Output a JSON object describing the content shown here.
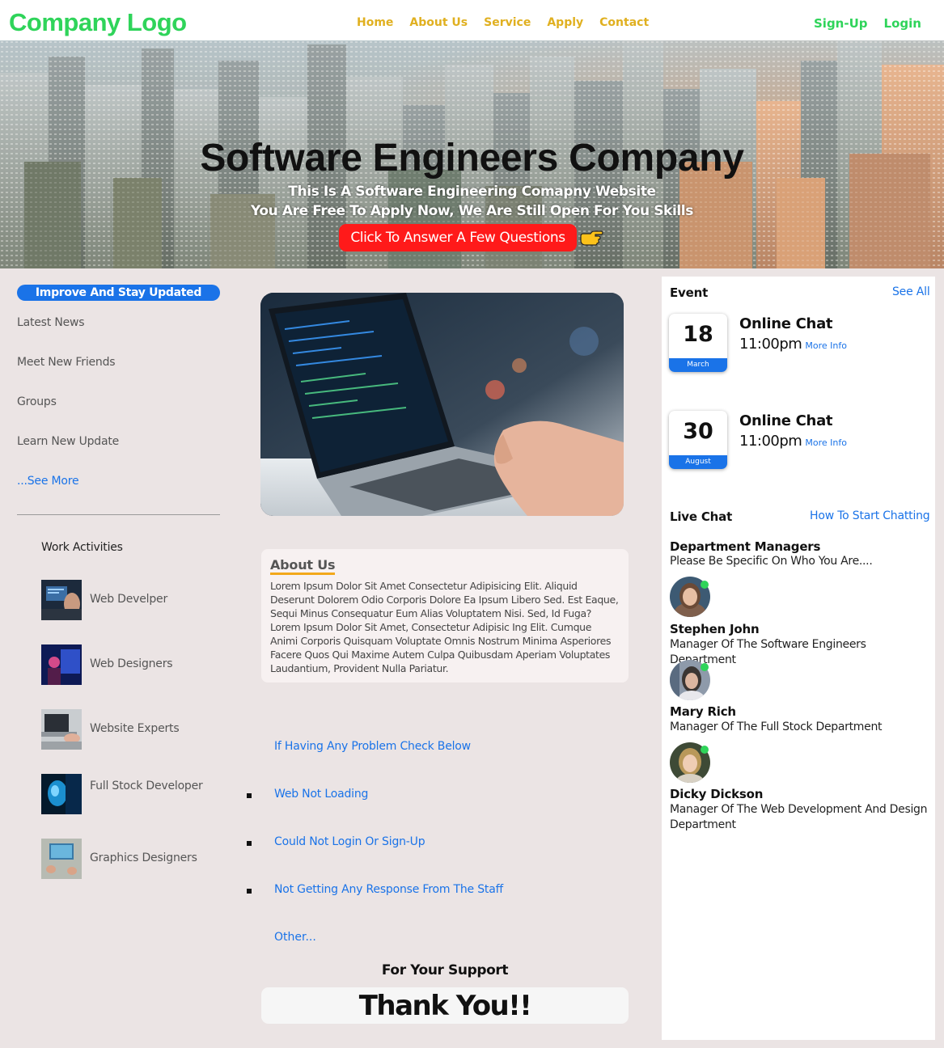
{
  "nav": {
    "logo": "Company Logo",
    "links": [
      "Home",
      "About Us",
      "Service",
      "Apply",
      "Contact"
    ],
    "signup": "Sign-Up",
    "login": "Login"
  },
  "hero": {
    "title": "Software Engineers Company",
    "line1": "This Is A Software Engineering Comapny Website",
    "line2": "You Are Free To Apply Now, We Are Still Open For You Skills",
    "cta": "Click To Answer A Few Questions",
    "cta_icon": "pointing-hand-icon"
  },
  "sidebar": {
    "pill": "Improve And Stay Updated",
    "links": [
      "Latest News",
      "Meet New Friends",
      "Groups",
      "Learn New Update"
    ],
    "see_more": "...See More",
    "work_title": "Work Activities",
    "work_items": [
      "Web Develper",
      "Web Designers",
      "Website Experts",
      "Full Stock Developer",
      "Graphics Designers"
    ]
  },
  "about": {
    "heading": "About Us",
    "body": "Lorem Ipsum Dolor Sit Amet Consectetur Adipisicing Elit. Aliquid Deserunt Dolorem Odio Corporis Dolore Ea Ipsum Libero Sed. Est Eaque, Sequi Minus Consequatur Eum Alias Voluptatem Nisi. Sed, Id Fuga? Lorem Ipsum Dolor Sit Amet, Consectetur Adipisic Ing Elit. Cumque Animi Corporis Quisquam Voluptate Omnis Nostrum Minima Asperiores Facere Quos Qui Maxime Autem Culpa Quibusdam Aperiam Voluptates Laudantium, Provident Nulla Pariatur."
  },
  "help": {
    "title": "If Having Any Problem Check Below",
    "items": [
      "Web Not Loading",
      "Could Not Login Or Sign-Up",
      "Not Getting Any Response From The Staff"
    ],
    "other": "Other..."
  },
  "footer": {
    "support": "For Your Support",
    "thanks": "Thank You!!"
  },
  "events": {
    "heading": "Event",
    "see_all": "See All",
    "items": [
      {
        "day": "18",
        "month": "March",
        "title": "Online Chat",
        "time": "11:00pm",
        "more": "More Info"
      },
      {
        "day": "30",
        "month": "August",
        "title": "Online Chat",
        "time": "11:00pm",
        "more": "More Info"
      }
    ]
  },
  "live_chat": {
    "heading": "Live Chat",
    "link": "How To Start Chatting",
    "dept_title": "Department Managers",
    "dept_sub": "Please Be Specific On Who You Are....",
    "managers": [
      {
        "name": "Stephen John",
        "role": "Manager Of The Software Engineers Department"
      },
      {
        "name": "Mary Rich",
        "role": "Manager Of The Full Stock Department"
      },
      {
        "name": "Dicky Dickson",
        "role": "Manager Of The Web Development And Design Department"
      }
    ]
  },
  "colors": {
    "logo": "#2fd45a",
    "nav_link": "#e0b020",
    "accent_blue": "#1a73e8",
    "cta_red": "#ff1a1a",
    "page_bg": "#ebe4e4"
  }
}
